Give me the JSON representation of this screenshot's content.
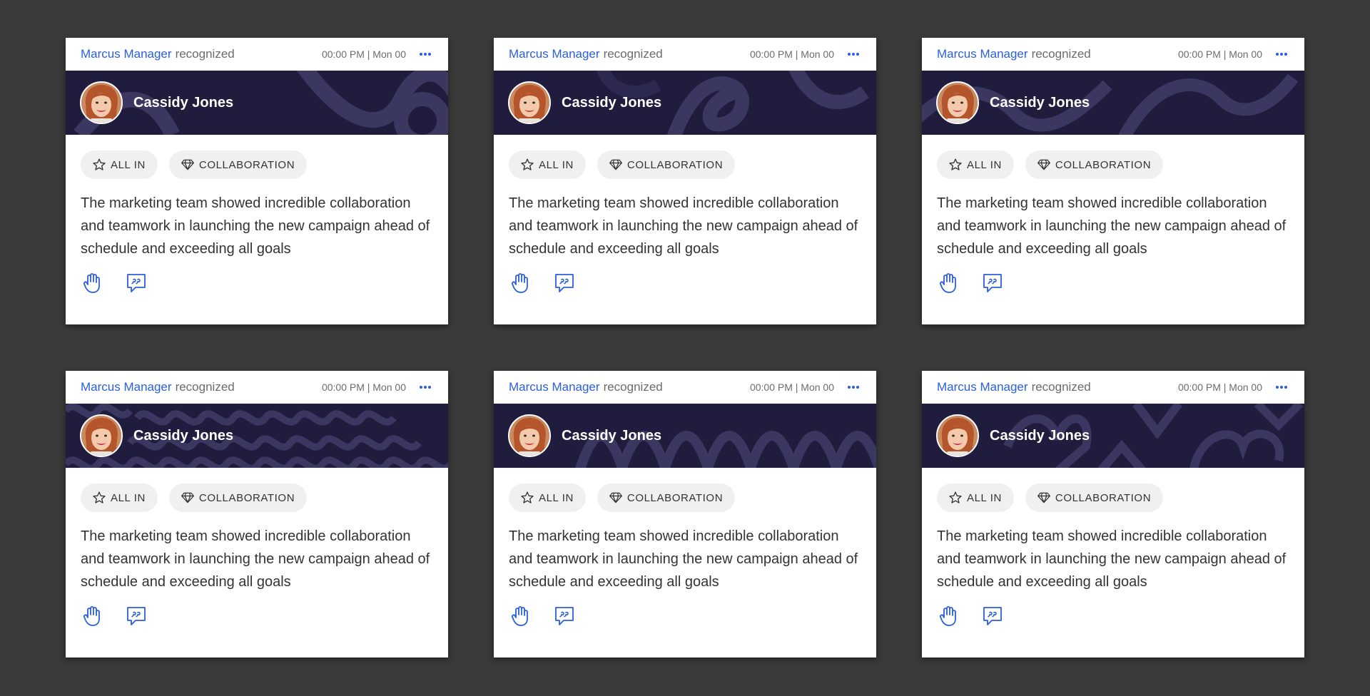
{
  "cards": [
    {
      "giver": "Marcus Manager",
      "verb": "recognized",
      "time": "00:00 PM | Mon 00",
      "recipient": "Cassidy Jones",
      "tags": [
        {
          "label": "ALL IN",
          "icon": "star-icon"
        },
        {
          "label": "COLLABORATION",
          "icon": "diamond-icon"
        }
      ],
      "message": "The marketing team showed incredible collaboration and teamwork in launching the new campaign ahead of schedule and exceeding all goals",
      "pattern": "swoosh"
    },
    {
      "giver": "Marcus Manager",
      "verb": "recognized",
      "time": "00:00 PM | Mon 00",
      "recipient": "Cassidy Jones",
      "tags": [
        {
          "label": "ALL IN",
          "icon": "star-icon"
        },
        {
          "label": "COLLABORATION",
          "icon": "diamond-icon"
        }
      ],
      "message": "The marketing team showed incredible collaboration and teamwork in launching the new campaign ahead of schedule and exceeding all goals",
      "pattern": "loops"
    },
    {
      "giver": "Marcus Manager",
      "verb": "recognized",
      "time": "00:00 PM | Mon 00",
      "recipient": "Cassidy Jones",
      "tags": [
        {
          "label": "ALL IN",
          "icon": "star-icon"
        },
        {
          "label": "COLLABORATION",
          "icon": "diamond-icon"
        }
      ],
      "message": "The marketing team showed incredible collaboration and teamwork in launching the new campaign ahead of schedule and exceeding all goals",
      "pattern": "waves"
    },
    {
      "giver": "Marcus Manager",
      "verb": "recognized",
      "time": "00:00 PM | Mon 00",
      "recipient": "Cassidy Jones",
      "tags": [
        {
          "label": "ALL IN",
          "icon": "star-icon"
        },
        {
          "label": "COLLABORATION",
          "icon": "diamond-icon"
        }
      ],
      "message": "The marketing team showed incredible collaboration and teamwork in launching the new campaign ahead of schedule and exceeding all goals",
      "pattern": "squiggles"
    },
    {
      "giver": "Marcus Manager",
      "verb": "recognized",
      "time": "00:00 PM | Mon 00",
      "recipient": "Cassidy Jones",
      "tags": [
        {
          "label": "ALL IN",
          "icon": "star-icon"
        },
        {
          "label": "COLLABORATION",
          "icon": "diamond-icon"
        }
      ],
      "message": "The marketing team showed incredible collaboration and teamwork in launching the new campaign ahead of schedule and exceeding all goals",
      "pattern": "zigzag"
    },
    {
      "giver": "Marcus Manager",
      "verb": "recognized",
      "time": "00:00 PM | Mon 00",
      "recipient": "Cassidy Jones",
      "tags": [
        {
          "label": "ALL IN",
          "icon": "star-icon"
        },
        {
          "label": "COLLABORATION",
          "icon": "diamond-icon"
        }
      ],
      "message": "The marketing team showed incredible collaboration and teamwork in launching the new campaign ahead of schedule and exceeding all goals",
      "pattern": "hearts"
    }
  ],
  "colors": {
    "page_background": "#3a3a3a",
    "banner": "#1f1c3d",
    "banner_pattern": "#3a3760",
    "accent_blue": "#2b5fd9",
    "tag_background": "#f0f0f0"
  },
  "actions": [
    {
      "name": "high-five",
      "icon": "hand-icon"
    },
    {
      "name": "comment",
      "icon": "quote-bubble-icon"
    }
  ]
}
